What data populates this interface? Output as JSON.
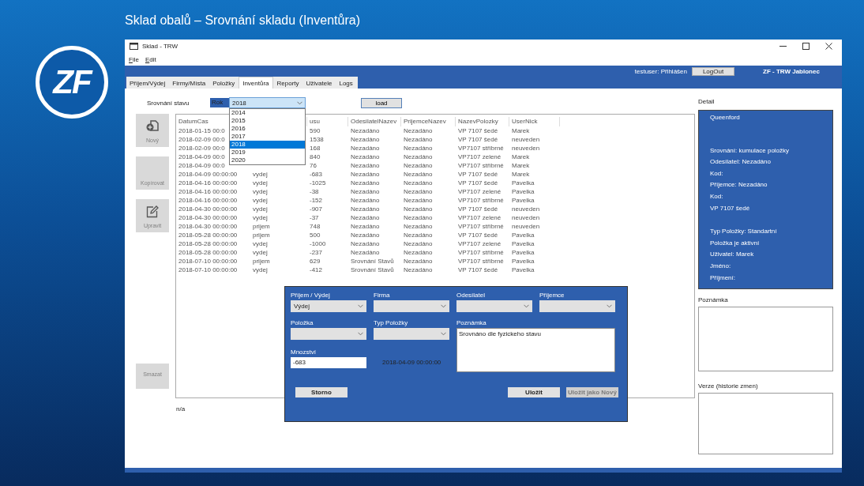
{
  "slide": {
    "title": "Sklad obalů – Srovnání skladu (Inventůra)",
    "logo": "ZF"
  },
  "window": {
    "title": "Sklad - TRW"
  },
  "menu": [
    {
      "label": "File"
    },
    {
      "label": "Edit"
    }
  ],
  "header": {
    "user": "testuser: Přihlášen",
    "logout": "LogOut",
    "site": "ZF - TRW Jablonec"
  },
  "tabs": [
    {
      "label": "Příjem/Výdej",
      "selected": false
    },
    {
      "label": "Firmy/Místa",
      "selected": false
    },
    {
      "label": "Položky",
      "selected": false
    },
    {
      "label": "Inventůra",
      "selected": true
    },
    {
      "label": "Reporty",
      "selected": false
    },
    {
      "label": "Uživatele",
      "selected": false
    },
    {
      "label": "Logs",
      "selected": false
    }
  ],
  "toolbar": {
    "label": "Srovnání stavu",
    "year_label": "Rok",
    "year": "2018",
    "load": "load",
    "year_options": [
      {
        "label": "2014",
        "selected": false
      },
      {
        "label": "2015",
        "selected": false
      },
      {
        "label": "2016",
        "selected": false
      },
      {
        "label": "2017",
        "selected": false
      },
      {
        "label": "2018",
        "selected": true
      },
      {
        "label": "2019",
        "selected": false
      },
      {
        "label": "2020",
        "selected": false
      }
    ]
  },
  "side_buttons": [
    {
      "label": "Nový",
      "kind": "new",
      "disabled": true
    },
    {
      "label": "Kopírovat",
      "kind": "plain",
      "disabled": true
    },
    {
      "label": "Upravit",
      "kind": "edit",
      "disabled": true
    },
    {
      "label": "Smazat",
      "kind": "plain",
      "disabled": true
    }
  ],
  "table": {
    "columns": [
      "DatumCas",
      null,
      "usu",
      "OdesilatelNazev",
      "PrijemceNazev",
      "NazevPolozky",
      "UserNick"
    ],
    "rows": [
      [
        "2018-01-15 00:0",
        null,
        "590",
        "Nezadáno",
        "Nezadáno",
        "VP 7107 šedé",
        "Marek"
      ],
      [
        "2018-02-09 00:0",
        null,
        "1538",
        "Nezadáno",
        "Nezadáno",
        "VP 7107 šedé",
        "neuveden"
      ],
      [
        "2018-02-09 00:0",
        null,
        "168",
        "Nezadáno",
        "Nezadáno",
        "VP7107 stříbrné",
        "neuveden"
      ],
      [
        "2018-04-09 00:0",
        null,
        "840",
        "Nezadáno",
        "Nezadáno",
        "VP7107 zelené",
        "Marek"
      ],
      [
        "2018-04-09 00:0",
        null,
        "76",
        "Nezadáno",
        "Nezadáno",
        "VP7107 stříbrné",
        "Marek"
      ],
      [
        "2018-04-09 00:00:00",
        "vydej",
        "-683",
        "Nezadáno",
        "Nezadáno",
        "VP 7107 šedé",
        "Marek"
      ],
      [
        "2018-04-16 00:00:00",
        "vydej",
        "-1025",
        "Nezadáno",
        "Nezadáno",
        "VP 7107 šedé",
        "Pavelka"
      ],
      [
        "2018-04-16 00:00:00",
        "vydej",
        "-38",
        "Nezadáno",
        "Nezadáno",
        "VP7107 zelené",
        "Pavelka"
      ],
      [
        "2018-04-16 00:00:00",
        "vydej",
        "-152",
        "Nezadáno",
        "Nezadáno",
        "VP7107 stříbrné",
        "Pavelka"
      ],
      [
        "2018-04-30 00:00:00",
        "vydej",
        "-907",
        "Nezadáno",
        "Nezadáno",
        "VP 7107 šedé",
        "neuveden"
      ],
      [
        "2018-04-30 00:00:00",
        "vydej",
        "-37",
        "Nezadáno",
        "Nezadáno",
        "VP7107 zelené",
        "neuveden"
      ],
      [
        "2018-04-30 00:00:00",
        "prijem",
        "748",
        "Nezadáno",
        "Nezadáno",
        "VP7107 stříbrné",
        "neuveden"
      ],
      [
        "2018-05-28 00:00:00",
        "prijem",
        "500",
        "Nezadáno",
        "Nezadáno",
        "VP 7107 šedé",
        "Pavelka"
      ],
      [
        "2018-05-28 00:00:00",
        "vydej",
        "-1000",
        "Nezadáno",
        "Nezadáno",
        "VP7107 zelené",
        "Pavelka"
      ],
      [
        "2018-05-28 00:00:00",
        "vydej",
        "-237",
        "Nezadáno",
        "Nezadáno",
        "VP7107 stříbrné",
        "Pavelka"
      ],
      [
        "2018-07-10 00:00:00",
        "prijem",
        "629",
        "Srovnání Stavů",
        "Nezadáno",
        "VP7107 stříbrné",
        "Pavelka"
      ],
      [
        "2018-07-10 00:00:00",
        "vydej",
        "-412",
        "Srovnání Stavů",
        "Nezadáno",
        "VP 7107 šedé",
        "Pavelka"
      ]
    ]
  },
  "status": "n/a",
  "dialog": {
    "selects": [
      {
        "label": "Příjem / Výdej",
        "value": "Výdej"
      },
      {
        "label": "Firma"
      },
      {
        "label": "Odesílatel"
      },
      {
        "label": "Příjemce"
      },
      {
        "label": "Položka"
      },
      {
        "label": "Typ Položky"
      }
    ],
    "note": {
      "label": "Poznámka",
      "value": "Srovnáno dle fyzickeho stavu"
    },
    "quantity": {
      "label": "Mnozství",
      "value": "-683"
    },
    "date": "2018-04-09 00:00:00",
    "buttons": [
      {
        "label": "Storno",
        "disabled": false
      },
      {
        "label": "Uložit",
        "disabled": false
      },
      {
        "label": "Uložit jako Nový",
        "disabled": true
      }
    ]
  },
  "detail": {
    "label": "Detail",
    "groups": [
      [
        "Queenford"
      ],
      [
        "Srovnání: kumulace položky",
        "Odesílatel: Nezadáno",
        "Kod:",
        "Příjemce: Nezadáno",
        "Kod:",
        "VP 7107 šedé"
      ],
      [
        "Typ Položky: Standartní",
        "Položka je aktivní",
        "Uživatel: Marek",
        "Jméno:",
        "Příjmení:"
      ]
    ]
  },
  "note_label": "Poznámka",
  "history_label": "Verze (historie zmen)"
}
